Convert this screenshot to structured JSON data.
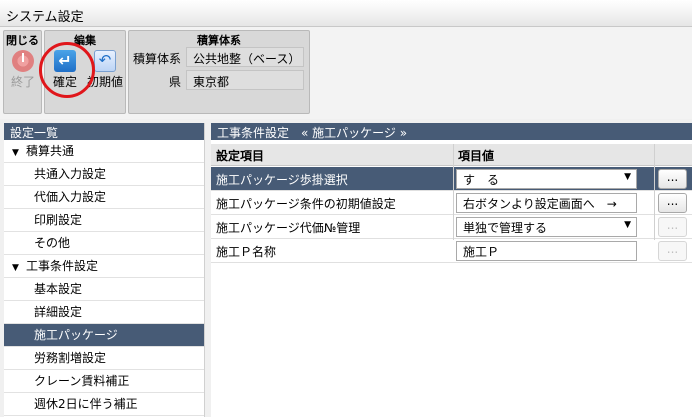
{
  "window": {
    "title": "システム設定"
  },
  "ribbon": {
    "close_group": {
      "title": "閉じる",
      "close_label": "終了"
    },
    "edit_group": {
      "title": "編集",
      "confirm_label": "確定",
      "reset_label": "初期値"
    },
    "estimate_group": {
      "title": "積算体系",
      "system_label": "積算体系",
      "system_value": "公共地整（ベース）",
      "prefecture_label": "県",
      "prefecture_value": "東京都"
    }
  },
  "sidebar": {
    "header": "設定一覧",
    "items": [
      {
        "label": "積算共通",
        "type": "parent"
      },
      {
        "label": "共通入力設定",
        "type": "child"
      },
      {
        "label": "代価入力設定",
        "type": "child"
      },
      {
        "label": "印刷設定",
        "type": "child"
      },
      {
        "label": "その他",
        "type": "child"
      },
      {
        "label": "工事条件設定",
        "type": "parent"
      },
      {
        "label": "基本設定",
        "type": "child"
      },
      {
        "label": "詳細設定",
        "type": "child"
      },
      {
        "label": "施工パッケージ",
        "type": "child",
        "selected": true
      },
      {
        "label": "労務割増設定",
        "type": "child"
      },
      {
        "label": "クレーン賃料補正",
        "type": "child"
      },
      {
        "label": "週休2日に伴う補正",
        "type": "child"
      }
    ]
  },
  "main": {
    "header": "工事条件設定　« 施工パッケージ »",
    "columns": {
      "item": "設定項目",
      "value": "項目値"
    },
    "rows": [
      {
        "name": "施工パッケージ歩掛選択",
        "value": "す　る",
        "control": "dropdown",
        "button": "...",
        "button_enabled": true,
        "selected": true
      },
      {
        "name": "施工パッケージ条件の初期値設定",
        "value": "右ボタンより設定画面へ　→",
        "control": "text",
        "button": "...",
        "button_enabled": true
      },
      {
        "name": "施工パッケージ代価№管理",
        "value": "単独で管理する",
        "control": "dropdown",
        "button": "...",
        "button_enabled": false
      },
      {
        "name": "施工Ｐ名称",
        "value": "施工Ｐ",
        "control": "text",
        "button": "...",
        "button_enabled": false
      }
    ]
  },
  "icons": [
    "power-icon",
    "confirm-icon",
    "reset-icon",
    "caret-down-icon",
    "dropdown-arrow-icon"
  ],
  "colors": {
    "selection": "#475b76",
    "annotation_circle": "#e0161b"
  }
}
